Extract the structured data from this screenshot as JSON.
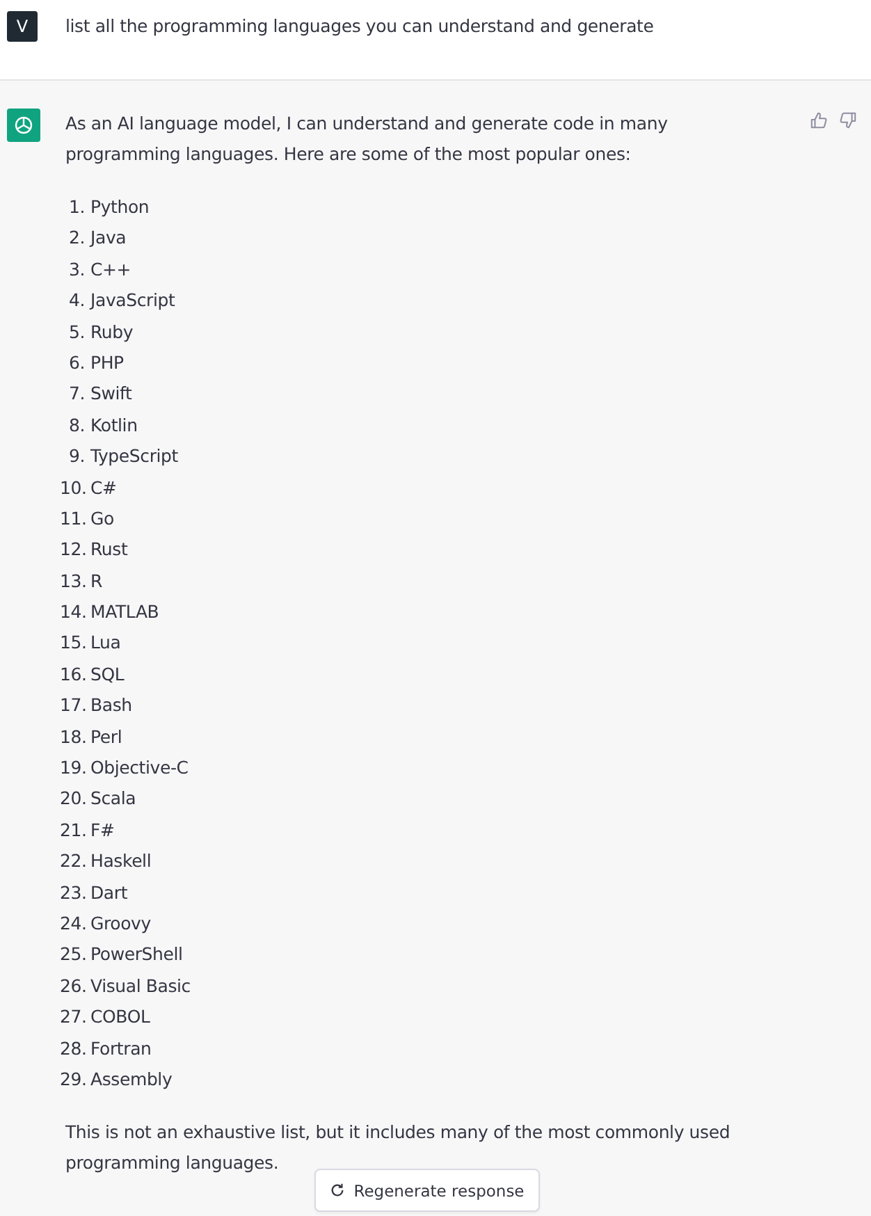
{
  "user_message": {
    "avatar": "V",
    "text": "list all the programming languages you can understand and generate"
  },
  "assistant_message": {
    "intro": "As an AI language model, I can understand and generate code in many programming languages. Here are some of the most popular ones:",
    "languages": [
      {
        "number": "1.",
        "name": "Python"
      },
      {
        "number": "2.",
        "name": "Java"
      },
      {
        "number": "3.",
        "name": "C++"
      },
      {
        "number": "4.",
        "name": "JavaScript"
      },
      {
        "number": "5.",
        "name": "Ruby"
      },
      {
        "number": "6.",
        "name": "PHP"
      },
      {
        "number": "7.",
        "name": "Swift"
      },
      {
        "number": "8.",
        "name": "Kotlin"
      },
      {
        "number": "9.",
        "name": "TypeScript"
      },
      {
        "number": "10.",
        "name": "C#"
      },
      {
        "number": "11.",
        "name": "Go"
      },
      {
        "number": "12.",
        "name": "Rust"
      },
      {
        "number": "13.",
        "name": "R"
      },
      {
        "number": "14.",
        "name": "MATLAB"
      },
      {
        "number": "15.",
        "name": "Lua"
      },
      {
        "number": "16.",
        "name": "SQL"
      },
      {
        "number": "17.",
        "name": "Bash"
      },
      {
        "number": "18.",
        "name": "Perl"
      },
      {
        "number": "19.",
        "name": "Objective-C"
      },
      {
        "number": "20.",
        "name": "Scala"
      },
      {
        "number": "21.",
        "name": "F#"
      },
      {
        "number": "22.",
        "name": "Haskell"
      },
      {
        "number": "23.",
        "name": "Dart"
      },
      {
        "number": "24.",
        "name": "Groovy"
      },
      {
        "number": "25.",
        "name": "PowerShell"
      },
      {
        "number": "26.",
        "name": "Visual Basic"
      },
      {
        "number": "27.",
        "name": "COBOL"
      },
      {
        "number": "28.",
        "name": "Fortran"
      },
      {
        "number": "29.",
        "name": "Assembly"
      }
    ],
    "outro": "This is not an exhaustive list, but it includes many of the most commonly used programming languages."
  },
  "regenerate_button": {
    "label": "Regenerate response"
  }
}
